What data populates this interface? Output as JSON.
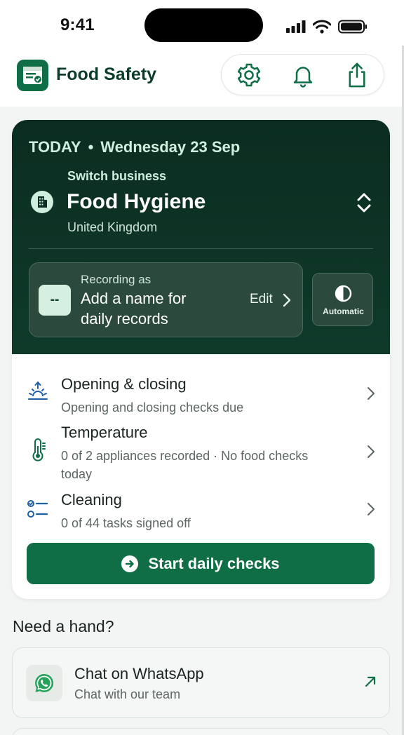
{
  "status_bar": {
    "time": "9:41"
  },
  "header": {
    "title": "Food Safety"
  },
  "today": {
    "label": "TODAY",
    "separator": "•",
    "date": "Wednesday 23 Sep",
    "switch_label": "Switch business",
    "business_name": "Food Hygiene",
    "country": "United Kingdom",
    "recording_label": "Recording as",
    "recording_value": "Add a name for daily records",
    "badge": "--",
    "edit_label": "Edit",
    "theme_label": "Automatic"
  },
  "checks": [
    {
      "title": "Opening & closing",
      "subtitle": "Opening and closing checks due"
    },
    {
      "title": "Temperature",
      "subtitle": "0 of 2 appliances recorded · No food checks today"
    },
    {
      "title": "Cleaning",
      "subtitle": "0 of 44 tasks signed off"
    }
  ],
  "start_button": {
    "label": "Start daily checks"
  },
  "help": {
    "title": "Need a hand?",
    "whatsapp_title": "Chat on WhatsApp",
    "whatsapp_sub": "Chat with our team"
  },
  "colors": {
    "brand": "#0f6e45",
    "dark_panel": "#0b2d21",
    "accent_text": "#cfeede"
  }
}
